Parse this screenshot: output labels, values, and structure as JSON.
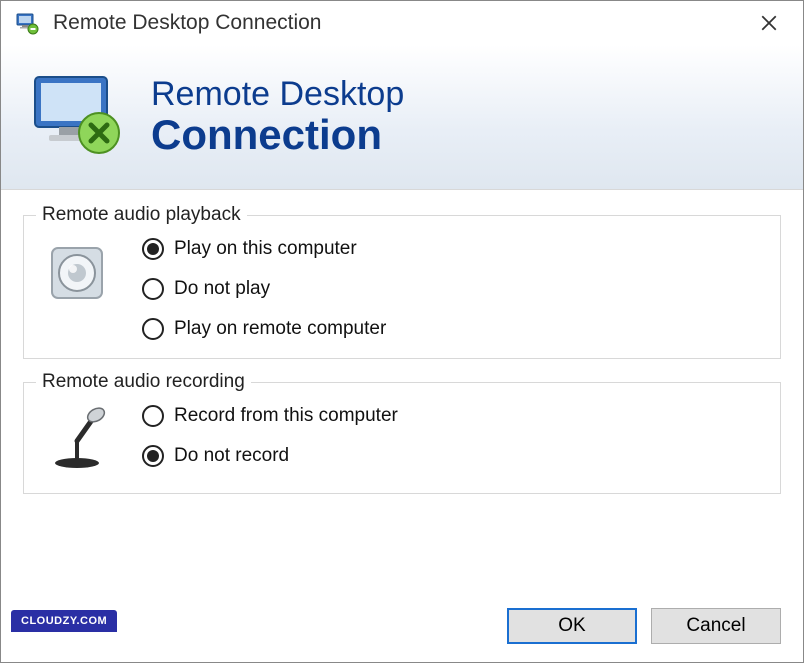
{
  "titlebar": {
    "title": "Remote Desktop Connection"
  },
  "banner": {
    "line1": "Remote Desktop",
    "line2": "Connection"
  },
  "groups": {
    "playback": {
      "legend": "Remote audio playback",
      "options": [
        {
          "label": "Play on this computer",
          "checked": true
        },
        {
          "label": "Do not play",
          "checked": false
        },
        {
          "label": "Play on remote computer",
          "checked": false
        }
      ]
    },
    "recording": {
      "legend": "Remote audio recording",
      "options": [
        {
          "label": "Record from this computer",
          "checked": false
        },
        {
          "label": "Do not record",
          "checked": true
        }
      ]
    }
  },
  "buttons": {
    "ok": "OK",
    "cancel": "Cancel"
  },
  "watermark": "CLOUDZY.COM"
}
